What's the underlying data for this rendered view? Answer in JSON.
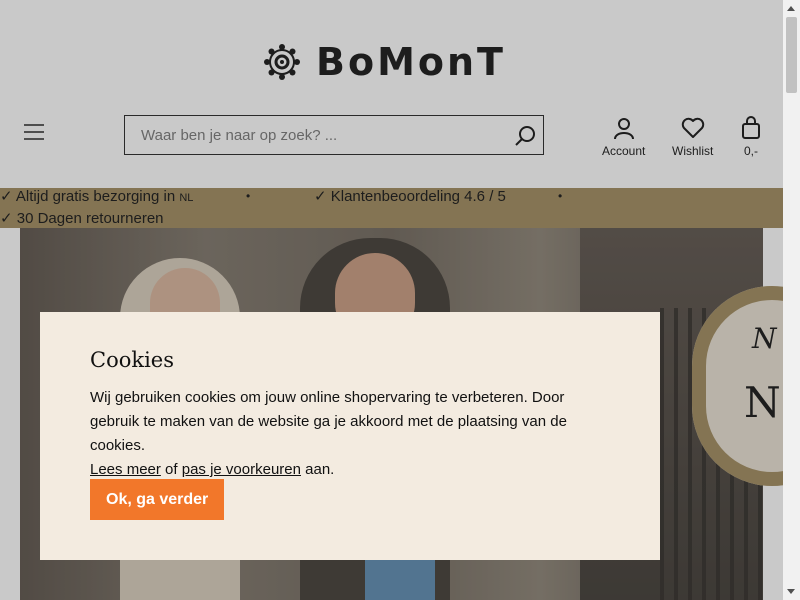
{
  "header": {
    "brand": "BoMonT",
    "search": {
      "placeholder": "Waar ben je naar op zoek? ..."
    },
    "account_label": "Account",
    "wishlist_label": "Wishlist",
    "cart_label": "0,-"
  },
  "usp_bar": {
    "items": [
      {
        "text": "✓ Altijd gratis bezorging in ",
        "suffix": "NL"
      },
      {
        "text": "✓ Klantenbeoordeling 4.6 / 5"
      },
      {
        "text": "✓ 30 Dagen retourneren"
      }
    ],
    "separator": "•"
  },
  "hero": {
    "badge_top": "N",
    "badge_main": "N"
  },
  "cookie": {
    "title": "Cookies",
    "body": "Wij gebruiken cookies om jouw online shopervaring te verbeteren. Door gebruik te maken van de website ga je akkoord met de plaatsing van de cookies.",
    "read_more": "Lees meer",
    "of": " of ",
    "preferences": "pas je voorkeuren",
    "suffix": " aan.",
    "accept_label": "Ok, ga verder"
  },
  "colors": {
    "usp_bg": "#a08a5c",
    "cookie_bg": "#f3ebe0",
    "accept_btn": "#f2772a"
  },
  "icons": [
    "menu-icon",
    "search-icon",
    "account-icon",
    "heart-icon",
    "bag-icon",
    "logo-mandala-icon"
  ]
}
